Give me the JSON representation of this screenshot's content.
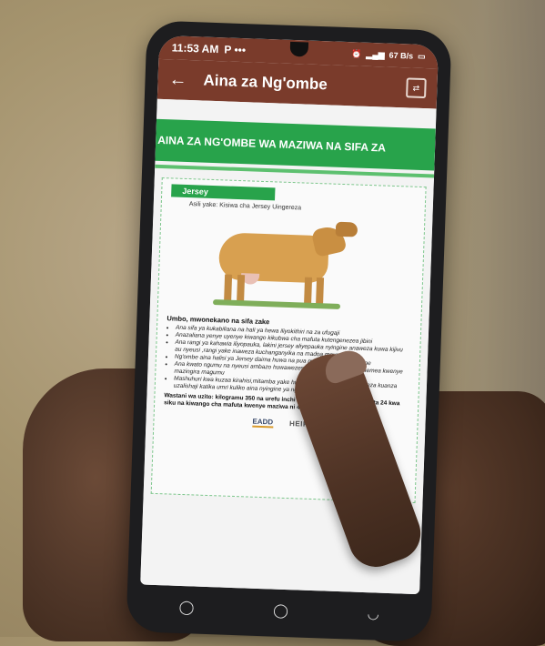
{
  "status_bar": {
    "time": "11:53 AM",
    "icons": "P •••",
    "speed": "67 B/s"
  },
  "app_bar": {
    "title": "Aina za Ng'ombe"
  },
  "banner": {
    "text": "AINA ZA NG'OMBE WA MAZIWA NA SIFA ZA"
  },
  "document": {
    "breed": "Jersey",
    "origin": "Asili yake: Kisiwa cha Jersey Uingereza",
    "section_title": "Umbo, mwonekano na sifa zake",
    "features": [
      "Ana sifa ya kukabiliana na hali ya hewa iliyokithiri na za ufugaji",
      "Anazaliana yenye uyenye kiwango kikubwa cha mafuta kutengenezea jibini",
      "Ana rangi ya kahawia iliyopauka, lakini jersey aliyepauka nyingine anaweza kuwa kijivu au nyeusi ,rangi yake inaweza kuchanganyika na madoa meupe",
      "Ng'ombe aina halisi ya Jersey daima huwa na pua nyeusi na lijinnu nyeupe",
      "Ana kwato ngumu na nyeusi ambazo huwawezeshakutoumia na kuchechemea kwenye mazingira magumu",
      "Mashuhuri kwa kuzaa kirahisi,mitamba yake hukomaa mapema nawanaweza kuanza uzalishaji katika umri kuliko aina nyingine ya ng'ombe wa maziwa"
    ],
    "weight_text": "Wastani wa uzito: kilogramu 350 na urefu inchi 48.Uzalishaji wa maziwa :Lita 24 kwa siku na kiwango cha mafuta kwenye maziwa ni 4.5%",
    "logos": [
      "EADD",
      "HEIFER"
    ]
  },
  "nav_bar": {
    "recents": "◯",
    "home": "◯",
    "back": "◡"
  }
}
